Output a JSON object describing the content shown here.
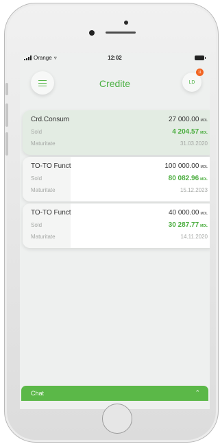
{
  "status": {
    "carrier": "Orange",
    "time": "12:02"
  },
  "header": {
    "title": "Credite",
    "avatar": "LD",
    "badge": "11",
    "menu_icon": "hamburger-icon"
  },
  "cards": [
    {
      "name": "Crd.Consum",
      "amount": "27 000.00",
      "currency": "MDL",
      "sold_label": "Sold",
      "sold": "4 204.57",
      "maturity_label": "Maturitate",
      "maturity": "31.03.2020"
    },
    {
      "name": "TO-TO Funct",
      "amount": "100 000.00",
      "currency": "MDL",
      "sold_label": "Sold",
      "sold": "80 082.96",
      "maturity_label": "Maturitate",
      "maturity": "15.12.2023"
    },
    {
      "name": "TO-TO Funct",
      "amount": "40 000.00",
      "currency": "MDL",
      "sold_label": "Sold",
      "sold": "30 287.77",
      "maturity_label": "Maturitate",
      "maturity": "14.11.2020"
    }
  ],
  "chat": {
    "label": "Chat",
    "icon": "chevron-up-icon"
  },
  "colors": {
    "accent": "#4bb043",
    "badge": "#f26522"
  }
}
